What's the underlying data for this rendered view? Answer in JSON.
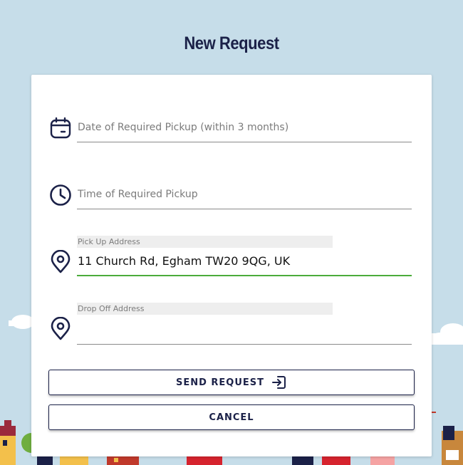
{
  "header": {
    "title": "New Request"
  },
  "form": {
    "date_field": {
      "placeholder": "Date of Required Pickup (within 3 months)",
      "icon": "calendar-icon"
    },
    "time_field": {
      "placeholder": "Time of Required Pickup",
      "icon": "clock-icon"
    },
    "pickup_field": {
      "label": "Pick Up Address",
      "value": "11 Church Rd, Egham TW20 9QG, UK",
      "icon": "location-pin-icon"
    },
    "dropoff_field": {
      "label": "Drop Off Address",
      "value": "",
      "icon": "location-pin-icon"
    }
  },
  "actions": {
    "send_label": "SEND REQUEST",
    "send_icon": "sign-in-icon",
    "cancel_label": "CANCEL"
  },
  "colors": {
    "background": "#c6dde9",
    "navy": "#1b2148",
    "active_underline": "#4bab3a"
  }
}
